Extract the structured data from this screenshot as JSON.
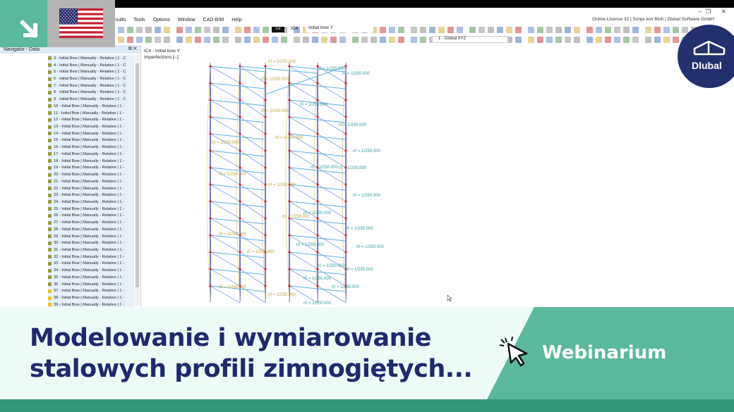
{
  "menu": [
    "esults",
    "Tools",
    "Options",
    "Window",
    "CAD-BIM",
    "Help"
  ],
  "license": "Online License 32 | Sonja von Bloh | Dlubal Software GmbH",
  "toolbar": {
    "loadcase_badge": "LoI",
    "loadcase_id": "IC4",
    "loadcase_name": "Initial bow Y",
    "coord_system": "1 - Global XYZ"
  },
  "navigator": {
    "title": "Navigator - Data",
    "items": [
      "3 - Initial Bow | Manually - Relative | 1 - C",
      "4 - Initial Bow | Manually - Relative | 1 - C",
      "5 - Initial Bow | Manually - Relative | 1 - C",
      "6 - Initial Bow | Manually - Relative | 1 - C",
      "7 - Initial Bow | Manually - Relative | 1 - C",
      "8 - Initial Bow | Manually - Relative | 1 - C",
      "9 - Initial Bow | Manually - Relative | 1 - C",
      "10 - Initial Bow | Manually - Relative | 1 -",
      "11 - Initial Bow | Manually - Relative | 1 -",
      "12 - Initial Bow | Manually - Relative | 1 -",
      "13 - Initial Bow | Manually - Relative | 1 -",
      "14 - Initial Bow | Manually - Relative | 1 -",
      "15 - Initial Bow | Manually - Relative | 1 -",
      "16 - Initial Bow | Manually - Relative | 1 -",
      "17 - Initial Bow | Manually - Relative | 1 -",
      "18 - Initial Bow | Manually - Relative | 1 -",
      "19 - Initial Bow | Manually - Relative | 1 -",
      "20 - Initial Bow | Manually - Relative | 1 -",
      "21 - Initial Bow | Manually - Relative | 1 -",
      "22 - Initial Bow | Manually - Relative | 1 -",
      "23 - Initial Bow | Manually - Relative | 1 -",
      "24 - Initial Bow | Manually - Relative | 1 -",
      "25 - Initial Bow | Manually - Relative | 1 -",
      "26 - Initial Bow | Manually - Relative | 1 -",
      "27 - Initial Bow | Manually - Relative | 1 -",
      "28 - Initial Bow | Manually - Relative | 1 -",
      "29 - Initial Bow | Manually - Relative | 1 -",
      "30 - Initial Bow | Manually - Relative | 1 -",
      "31 - Initial Bow | Manually - Relative | 1 -",
      "32 - Initial Bow | Manually - Relative | 1 -",
      "33 - Initial Bow | Manually - Relative | 1 -",
      "34 - Initial Bow | Manually - Relative | 1 -",
      "35 - Initial Bow | Manually - Relative | 1 -",
      "36 - Initial Bow | Manually - Relative | 1 -",
      "37 - Initial Bow | Manually - Relative | 1 -",
      "38 - Initial Bow | Manually - Relative | 1 -",
      "39 - Initial Bow | Manually - Relative | 1 -"
    ]
  },
  "viewport": {
    "title": "IC4 - Initial bow Y",
    "subtitle": "Imperfections [--]",
    "label": "r0 = 1/250.000"
  },
  "banner": {
    "line1": "Modelowanie i wymiarowanie",
    "line2": "stalowych profili zimnogiętych...",
    "tag": "Webinarium",
    "brand": "Dlubal"
  },
  "colors": {
    "green": "#5ab89c",
    "dark_green": "#33967a",
    "navy": "#1e2a6e",
    "olive": "#9a9a3a",
    "yellow": "#f2c21a"
  }
}
